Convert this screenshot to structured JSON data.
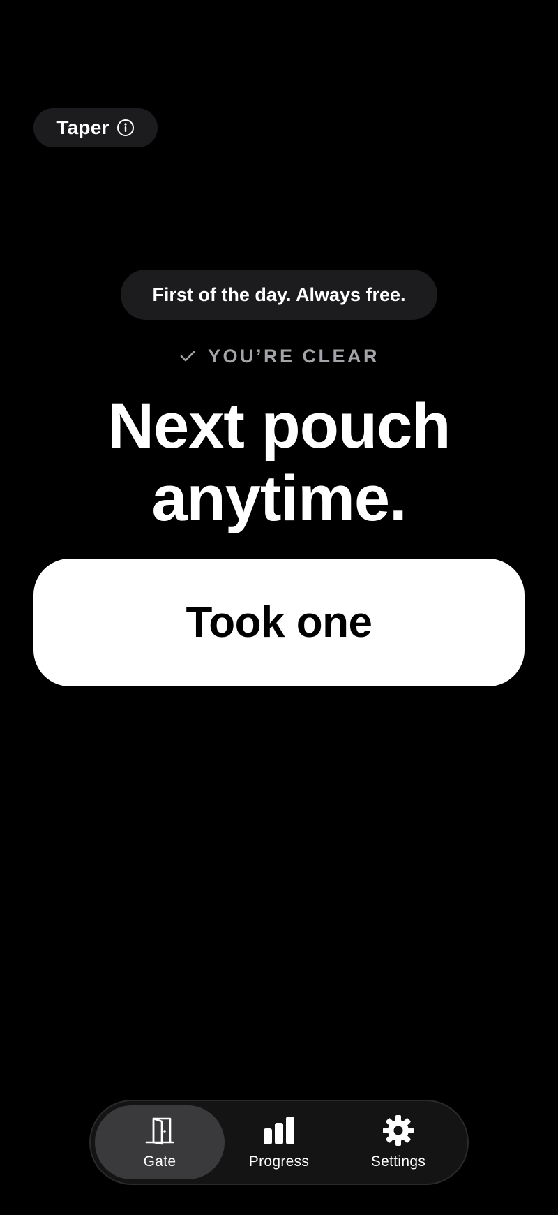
{
  "header": {
    "app_name": "Taper",
    "info_icon": "info-circle-icon"
  },
  "notice": {
    "text": "First of the day. Always free."
  },
  "status": {
    "icon": "checkmark-icon",
    "label": "YOU’RE CLEAR"
  },
  "headline": {
    "line1": "Next pouch",
    "line2": "anytime."
  },
  "primary_action": {
    "label": "Took one"
  },
  "tabbar": {
    "active": "Gate",
    "tabs": [
      {
        "label": "Gate",
        "icon": "door-icon"
      },
      {
        "label": "Progress",
        "icon": "bar-chart-icon"
      },
      {
        "label": "Settings",
        "icon": "gear-icon"
      }
    ]
  },
  "colors": {
    "background": "#000000",
    "pill": "#1c1c1e",
    "status_text": "#a3a3a8",
    "button": "#ffffff",
    "button_text": "#000000",
    "tabbar": "#141414",
    "tab_active": "#3a3a3c"
  }
}
